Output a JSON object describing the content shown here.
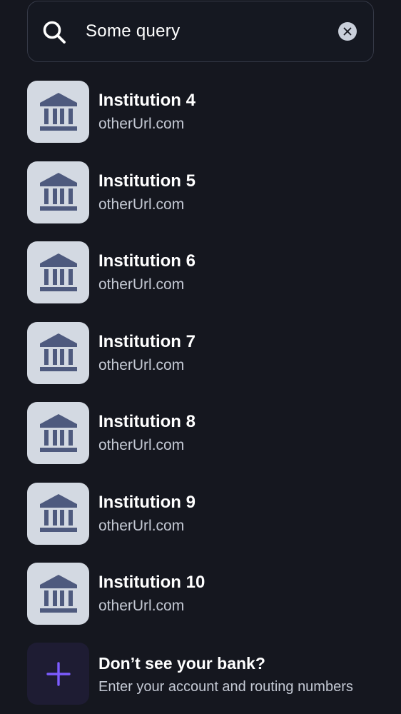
{
  "search": {
    "value": "Some query",
    "icon": "search-icon",
    "clear_icon": "close-icon"
  },
  "institutions": [
    {
      "name": "Institution 4",
      "url": "otherUrl.com"
    },
    {
      "name": "Institution 5",
      "url": "otherUrl.com"
    },
    {
      "name": "Institution 6",
      "url": "otherUrl.com"
    },
    {
      "name": "Institution 7",
      "url": "otherUrl.com"
    },
    {
      "name": "Institution 8",
      "url": "otherUrl.com"
    },
    {
      "name": "Institution 9",
      "url": "otherUrl.com"
    },
    {
      "name": "Institution 10",
      "url": "otherUrl.com"
    }
  ],
  "manual_entry": {
    "title": "Don’t see your bank?",
    "subtitle": "Enter your account and routing numbers"
  },
  "colors": {
    "background": "#15171f",
    "logo_tile": "#d3d9e2",
    "bank_icon": "#4e5a7e",
    "accent": "#7c5cff"
  }
}
